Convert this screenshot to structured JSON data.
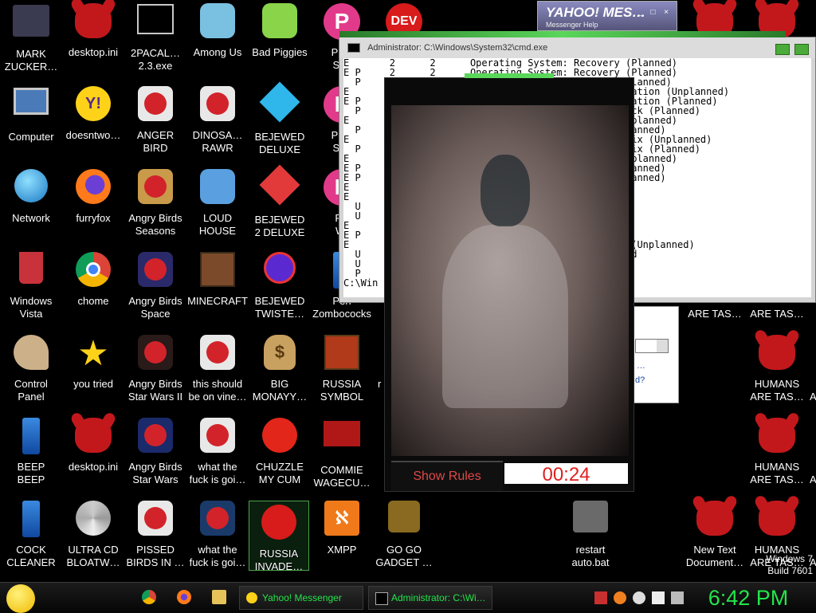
{
  "desktop": {
    "icons": [
      {
        "id": "mark",
        "label": "MARK ZUCKER…",
        "l1": "MARK",
        "l2": "ZUCKER…",
        "icon": "folder-icon"
      },
      {
        "id": "desktop-ini-1",
        "l1": "desktop.ini",
        "l2": "",
        "icon": "demon-icon"
      },
      {
        "id": "2pacal",
        "l1": "2PACAL…",
        "l2": "2.3.exe",
        "icon": "cmd-icon"
      },
      {
        "id": "among-us",
        "l1": "Among Us",
        "l2": "",
        "icon": "game-icon"
      },
      {
        "id": "bad-piggies",
        "l1": "Bad Piggies",
        "l2": "",
        "icon": "pig-icon"
      },
      {
        "id": "pec-1",
        "l1": "PEC",
        "l2": "SIM",
        "icon": "p-logo-icon"
      },
      {
        "id": "computer",
        "l1": "Computer",
        "l2": "",
        "icon": "computer-icon"
      },
      {
        "id": "doesntwo",
        "l1": "doesntwo…",
        "l2": "",
        "icon": "yahoo-icon"
      },
      {
        "id": "anger-bird",
        "l1": "ANGER",
        "l2": "BIRD",
        "icon": "angry-bird-icon"
      },
      {
        "id": "dinosa",
        "l1": "DINOSA…",
        "l2": "RAWR",
        "icon": "angry-bird-icon"
      },
      {
        "id": "bejewed-deluxe",
        "l1": "BEJEWED",
        "l2": "DELUXE",
        "icon": "gem-icon"
      },
      {
        "id": "pec-2",
        "l1": "PEC",
        "l2": "SIM",
        "icon": "p-logo-icon"
      },
      {
        "id": "network",
        "l1": "Network",
        "l2": "",
        "icon": "globe-icon"
      },
      {
        "id": "furryfox",
        "l1": "furryfox",
        "l2": "",
        "icon": "firefox-icon"
      },
      {
        "id": "ab-seasons",
        "l1": "Angry Birds",
        "l2": "Seasons",
        "icon": "angry-bird-icon"
      },
      {
        "id": "loud-house",
        "l1": "LOUD",
        "l2": "HOUSE",
        "icon": "game-icon"
      },
      {
        "id": "bejewed-2",
        "l1": "BEJEWED",
        "l2": "2 DELUXE",
        "icon": "gem-icon"
      },
      {
        "id": "pe-wi",
        "l1": "PE",
        "l2": "WI",
        "icon": "p-logo-icon"
      },
      {
        "id": "windows-vista",
        "l1": "Windows",
        "l2": "Vista",
        "icon": "recycle-bin-icon"
      },
      {
        "id": "chome",
        "l1": "chome",
        "l2": "",
        "icon": "chrome-icon"
      },
      {
        "id": "ab-space",
        "l1": "Angry Birds",
        "l2": "Space",
        "icon": "angry-bird-icon"
      },
      {
        "id": "minecraft",
        "l1": "MINECRAFT",
        "l2": "",
        "icon": "minecraft-icon"
      },
      {
        "id": "bejewed-twist",
        "l1": "BEJEWED",
        "l2": "TWISTE…",
        "icon": "ruby-icon"
      },
      {
        "id": "pen-zombo",
        "l1": "Pen",
        "l2": "Zombococks",
        "icon": "blue-bar-icon"
      },
      {
        "id": "control-panel",
        "l1": "Control",
        "l2": "Panel",
        "icon": "palette-icon"
      },
      {
        "id": "you-tried",
        "l1": "you tried",
        "l2": "",
        "icon": "star-icon"
      },
      {
        "id": "ab-starwars2",
        "l1": "Angry Birds",
        "l2": "Star Wars II",
        "icon": "angry-bird-icon"
      },
      {
        "id": "vine",
        "l1": "this should",
        "l2": "be on vine…",
        "icon": "angry-bird-icon"
      },
      {
        "id": "big-money",
        "l1": "BIG",
        "l2": "MONAYY…",
        "icon": "money-icon"
      },
      {
        "id": "russia-symbol",
        "l1": "RUSSIA",
        "l2": "SYMBOL",
        "icon": "cube-icon"
      },
      {
        "id": "beep-beep",
        "l1": "BEEP",
        "l2": "BEEP",
        "icon": "blue-bar-icon"
      },
      {
        "id": "desktop-ini-2",
        "l1": "desktop.ini",
        "l2": "",
        "icon": "demon-icon"
      },
      {
        "id": "ab-starwars",
        "l1": "Angry Birds",
        "l2": "Star Wars",
        "icon": "angry-bird-icon"
      },
      {
        "id": "what-1",
        "l1": "what the",
        "l2": "fuck is goi…",
        "icon": "angry-bird-icon"
      },
      {
        "id": "chuzzle",
        "l1": "CHUZZLE",
        "l2": "MY CUM",
        "icon": "chuzzle-icon"
      },
      {
        "id": "commie",
        "l1": "COMMIE",
        "l2": "WAGECU…",
        "icon": "hammer-icon"
      },
      {
        "id": "cock-cleaner",
        "l1": "COCK",
        "l2": "CLEANER",
        "icon": "blue-bar-icon"
      },
      {
        "id": "ultra-cd",
        "l1": "ULTRA CD",
        "l2": "BLOATW…",
        "icon": "disc-icon"
      },
      {
        "id": "pissed-birds",
        "l1": "PISSED",
        "l2": "BIRDS IN …",
        "icon": "angry-bird-icon"
      },
      {
        "id": "what-2",
        "l1": "what the",
        "l2": "fuck is goi…",
        "icon": "angry-bird-icon"
      },
      {
        "id": "russia-invade",
        "l1": "RUSSIA",
        "l2": "INVADE…",
        "icon": "radiation-icon"
      },
      {
        "id": "xmpp",
        "l1": "XMPP",
        "l2": "",
        "icon": "xampp-icon"
      },
      {
        "id": "gogo",
        "l1": "GO GO",
        "l2": "GADGET …",
        "icon": "briefcase-icon"
      },
      {
        "id": "restart",
        "l1": "restart",
        "l2": "auto.bat",
        "icon": "gear-icon"
      },
      {
        "id": "new-text",
        "l1": "New Text",
        "l2": "Document…",
        "icon": "demon-icon"
      },
      {
        "id": "humans-1",
        "l1": "HUMANS",
        "l2": "ARE TAS…",
        "icon": "demon-icon"
      },
      {
        "id": "humans-2",
        "l1": "HUMANS",
        "l2": "ARE TAS…",
        "icon": "demon-icon"
      },
      {
        "id": "humans-3",
        "l1": "HUMANS",
        "l2": "ARE TAS…",
        "icon": "demon-icon"
      },
      {
        "id": "dev",
        "l1": "",
        "l2": "",
        "icon": "dev-icon"
      },
      {
        "id": "top-demon-1",
        "l1": "",
        "l2": "",
        "icon": "demon-icon"
      },
      {
        "id": "top-demon-2",
        "l1": "",
        "l2": "",
        "icon": "demon-icon"
      },
      {
        "id": "mid-demon-1",
        "l1": "",
        "l2": "",
        "icon": "demon-icon"
      }
    ],
    "partial_labels": {
      "are_tas_1": "ARE TAS…",
      "are_tas_2": "ARE TAS…",
      "stray_r": "r",
      "stray_a1": "A",
      "stray_a2": "A",
      "stray_a3": "A"
    },
    "dev_text": "DEV",
    "pec_letter": "P",
    "yahoo_letter": "Y!",
    "money_symbol": "$",
    "xampp_symbol": "ℵ",
    "star_symbol": "★",
    "shortcut_arrow": "↗"
  },
  "yahoo_widget": {
    "logo": "YAHOO! MES…",
    "sub": "Messenger    Help",
    "controls": "_ □ ×"
  },
  "cmd_window": {
    "title": "Administrator: C:\\Windows\\System32\\cmd.exe",
    "lines": [
      "E       2      2      Operating System: Recovery (Planned)",
      "E P     2      2      Operating System: Recovery (Planned)",
      "  P                                        rade (Planned)",
      "E                                          onfiguration (Unplanned)",
      "E P                                        onfiguration (Planned)",
      "  P                                        vice pack (Planned)",
      "E                                          fix (Unplanned)",
      "  P                                        fix (Planned)",
      "E                                          urity fix (Unplanned)",
      "  P                                        urity fix (Planned)",
      "E                                          nce (Unplanned)",
      "E P                                        nce (Planned)",
      "E P                                        ion (Planned)",
      "E                                          ive",
      "E",
      "  U                                        error",
      "  U",
      "E",
      "E P",
      "E                                          tivity (Unplanned)",
      "  U                                        nplugged",
      "  U                                        ment",
      "  P",
      "C:\\Win"
    ]
  },
  "video_window": {
    "rules_label": "Show Rules",
    "timer": "00:24"
  },
  "taskbar": {
    "yahoo_btn": "Yahoo! Messenger",
    "cmd_btn": "Administrator: C:\\Wi…",
    "clock": "6:42 PM"
  },
  "watermark": {
    "line1": "Windows 7",
    "line2": "Build 7601"
  },
  "colors": {
    "accent_green": "#22e54a",
    "demon_red": "#c2181c",
    "rules_red": "#e04848"
  }
}
